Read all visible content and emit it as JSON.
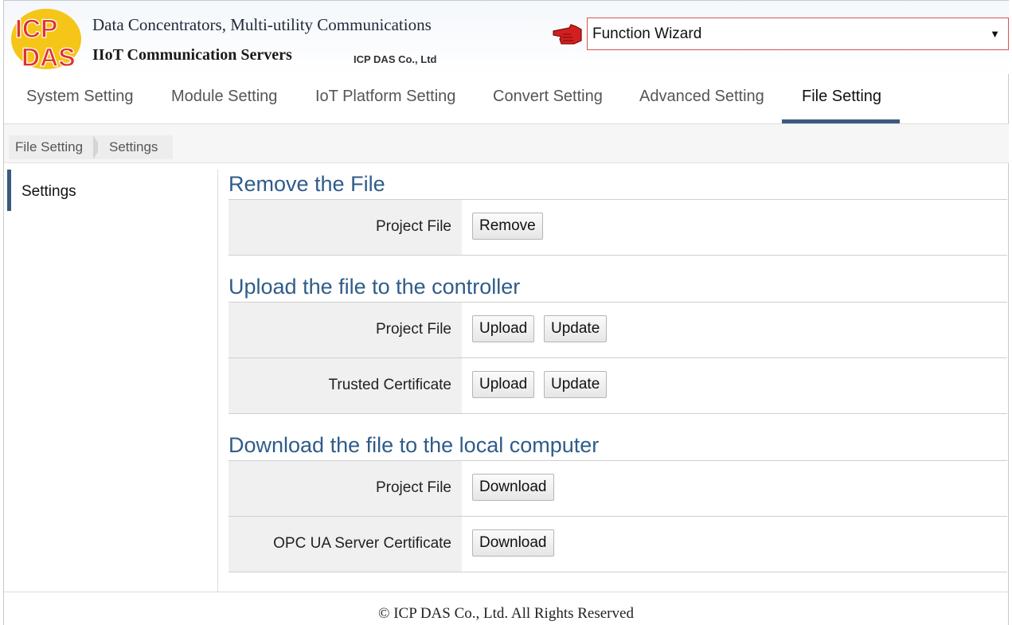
{
  "header": {
    "logo_text": "ICP DAS",
    "title_line1": "Data Concentrators, Multi-utility Communications",
    "title_line2": "IIoT Communication Servers",
    "company": "ICP DAS Co., Ltd",
    "function_select": {
      "value": "Function Wizard",
      "border_color": "#d9534f"
    }
  },
  "tabs": [
    {
      "label": "System Setting",
      "active": false
    },
    {
      "label": "Module Setting",
      "active": false
    },
    {
      "label": "IoT Platform Setting",
      "active": false
    },
    {
      "label": "Convert Setting",
      "active": false
    },
    {
      "label": "Advanced Setting",
      "active": false
    },
    {
      "label": "File Setting",
      "active": true
    }
  ],
  "breadcrumb": [
    "File Setting",
    "Settings"
  ],
  "sidebar": {
    "items": [
      {
        "label": "Settings",
        "active": true
      }
    ]
  },
  "sections": [
    {
      "title": "Remove the File",
      "rows": [
        {
          "label": "Project File",
          "buttons": [
            "Remove"
          ]
        }
      ]
    },
    {
      "title": "Upload the file to the controller",
      "rows": [
        {
          "label": "Project File",
          "buttons": [
            "Upload",
            "Update"
          ]
        },
        {
          "label": "Trusted Certificate",
          "buttons": [
            "Upload",
            "Update"
          ]
        }
      ]
    },
    {
      "title": "Download the file to the local computer",
      "rows": [
        {
          "label": "Project File",
          "buttons": [
            "Download"
          ]
        },
        {
          "label": "OPC UA Server Certificate",
          "buttons": [
            "Download"
          ]
        }
      ]
    }
  ],
  "footer": {
    "copyright": "© ICP DAS Co., Ltd. All Rights Reserved"
  },
  "colors": {
    "accent": "#3a5a80",
    "section_title": "#2f5c8a",
    "logo_red": "#e0322b",
    "logo_yellow": "#f5c518"
  }
}
